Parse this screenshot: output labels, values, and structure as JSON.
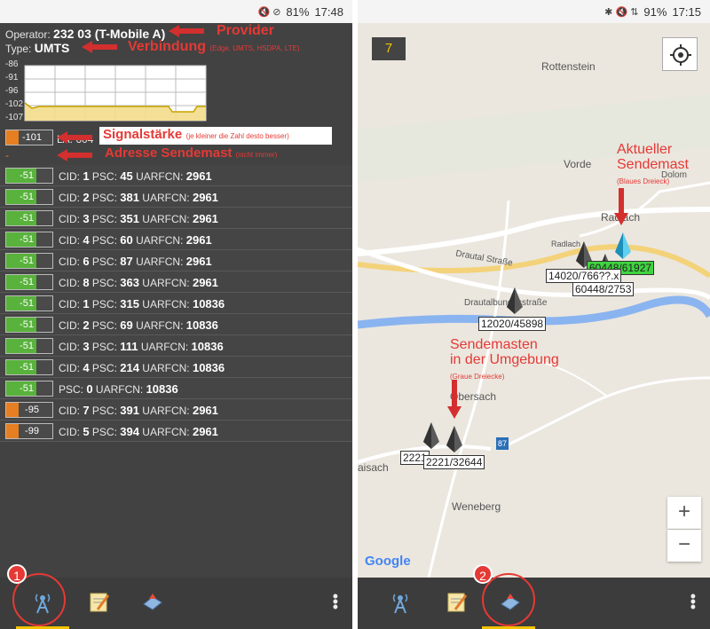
{
  "left_status": {
    "icons": "🔇 ⊘",
    "battery": "81%",
    "time": "17:48"
  },
  "right_status": {
    "icons": "✱ 🔇 ⇅",
    "battery": "91%",
    "time": "17:15"
  },
  "info": {
    "operator_label": "Operator:",
    "operator_value": "232 03 (T-Mobile A)",
    "type_label": "Type:",
    "type_value": "UMTS",
    "chart_ticks": [
      "-86",
      "-91",
      "-96",
      "-102",
      "-107"
    ],
    "current_signal": "-101",
    "current_cell_partial": "LA: 604",
    "address_dash": "-"
  },
  "annotations": {
    "provider": "Provider",
    "verbindung": "Verbindung",
    "verbindung_note": "(Edge, UMTS, HSDPA, LTE)",
    "signal": "Signalstärke",
    "signal_note": "(je kleiner die Zahl desto besser)",
    "adresse": "Adresse Sendemast",
    "adresse_note": "(nicht immer)",
    "aktueller1": "Aktueller",
    "aktueller2": "Sendemast",
    "aktueller_note": "(Blaues Dreieck)",
    "umgebung1": "Sendemasten",
    "umgebung2": "in der Umgebung",
    "umgebung_note": "(Graue Dreiecke)",
    "badge1": "1",
    "badge2": "2"
  },
  "cells": [
    {
      "sig": "-51",
      "orange": false,
      "parts": [
        [
          "CID: ",
          "1"
        ],
        [
          " PSC: ",
          "45"
        ],
        [
          " UARFCN: ",
          "2961"
        ]
      ]
    },
    {
      "sig": "-51",
      "orange": false,
      "parts": [
        [
          "CID: ",
          "2"
        ],
        [
          " PSC: ",
          "381"
        ],
        [
          " UARFCN: ",
          "2961"
        ]
      ]
    },
    {
      "sig": "-51",
      "orange": false,
      "parts": [
        [
          "CID: ",
          "3"
        ],
        [
          " PSC: ",
          "351"
        ],
        [
          " UARFCN: ",
          "2961"
        ]
      ]
    },
    {
      "sig": "-51",
      "orange": false,
      "parts": [
        [
          "CID: ",
          "4"
        ],
        [
          " PSC: ",
          "60"
        ],
        [
          " UARFCN: ",
          "2961"
        ]
      ]
    },
    {
      "sig": "-51",
      "orange": false,
      "parts": [
        [
          "CID: ",
          "6"
        ],
        [
          " PSC: ",
          "87"
        ],
        [
          " UARFCN: ",
          "2961"
        ]
      ]
    },
    {
      "sig": "-51",
      "orange": false,
      "parts": [
        [
          "CID: ",
          "8"
        ],
        [
          " PSC: ",
          "363"
        ],
        [
          " UARFCN: ",
          "2961"
        ]
      ]
    },
    {
      "sig": "-51",
      "orange": false,
      "parts": [
        [
          "CID: ",
          "1"
        ],
        [
          " PSC: ",
          "315"
        ],
        [
          " UARFCN: ",
          "10836"
        ]
      ]
    },
    {
      "sig": "-51",
      "orange": false,
      "parts": [
        [
          "CID: ",
          "2"
        ],
        [
          " PSC: ",
          "69"
        ],
        [
          " UARFCN: ",
          "10836"
        ]
      ]
    },
    {
      "sig": "-51",
      "orange": false,
      "parts": [
        [
          "CID: ",
          "3"
        ],
        [
          " PSC: ",
          "111"
        ],
        [
          " UARFCN: ",
          "10836"
        ]
      ]
    },
    {
      "sig": "-51",
      "orange": false,
      "parts": [
        [
          "CID: ",
          "4"
        ],
        [
          " PSC: ",
          "214"
        ],
        [
          " UARFCN: ",
          "10836"
        ]
      ]
    },
    {
      "sig": "-51",
      "orange": false,
      "parts": [
        [
          "PSC: ",
          "0"
        ],
        [
          " UARFCN: ",
          "10836"
        ]
      ]
    },
    {
      "sig": "-95",
      "orange": true,
      "parts": [
        [
          "CID: ",
          "7"
        ],
        [
          " PSC: ",
          "391"
        ],
        [
          " UARFCN: ",
          "2961"
        ]
      ]
    },
    {
      "sig": "-99",
      "orange": true,
      "parts": [
        [
          "CID: ",
          "5"
        ],
        [
          " PSC: ",
          "394"
        ],
        [
          " UARFCN: ",
          "2961"
        ]
      ]
    }
  ],
  "map": {
    "zoom_level": "7",
    "towns": {
      "rottenstein": "Rottenstein",
      "vorde": "Vorde",
      "radlach": "Radlach",
      "obersach": "Obersach",
      "weneberg": "Weneberg",
      "aisach": "aisach",
      "dolo": "Dolom"
    },
    "roads": {
      "drautal": "Drautal Straße",
      "drautalbundes": "Drautalbundesstraße",
      "radlach_road": "Radlach",
      "road87": "87"
    },
    "towers": {
      "t1": "14020/766??.x",
      "t2": "60448/2753",
      "t3": "12020/45898",
      "t4": "2221/32644",
      "t5": "2221",
      "current": "60448/61927"
    },
    "google": "Google",
    "zoom_in": "+",
    "zoom_out": "−"
  }
}
